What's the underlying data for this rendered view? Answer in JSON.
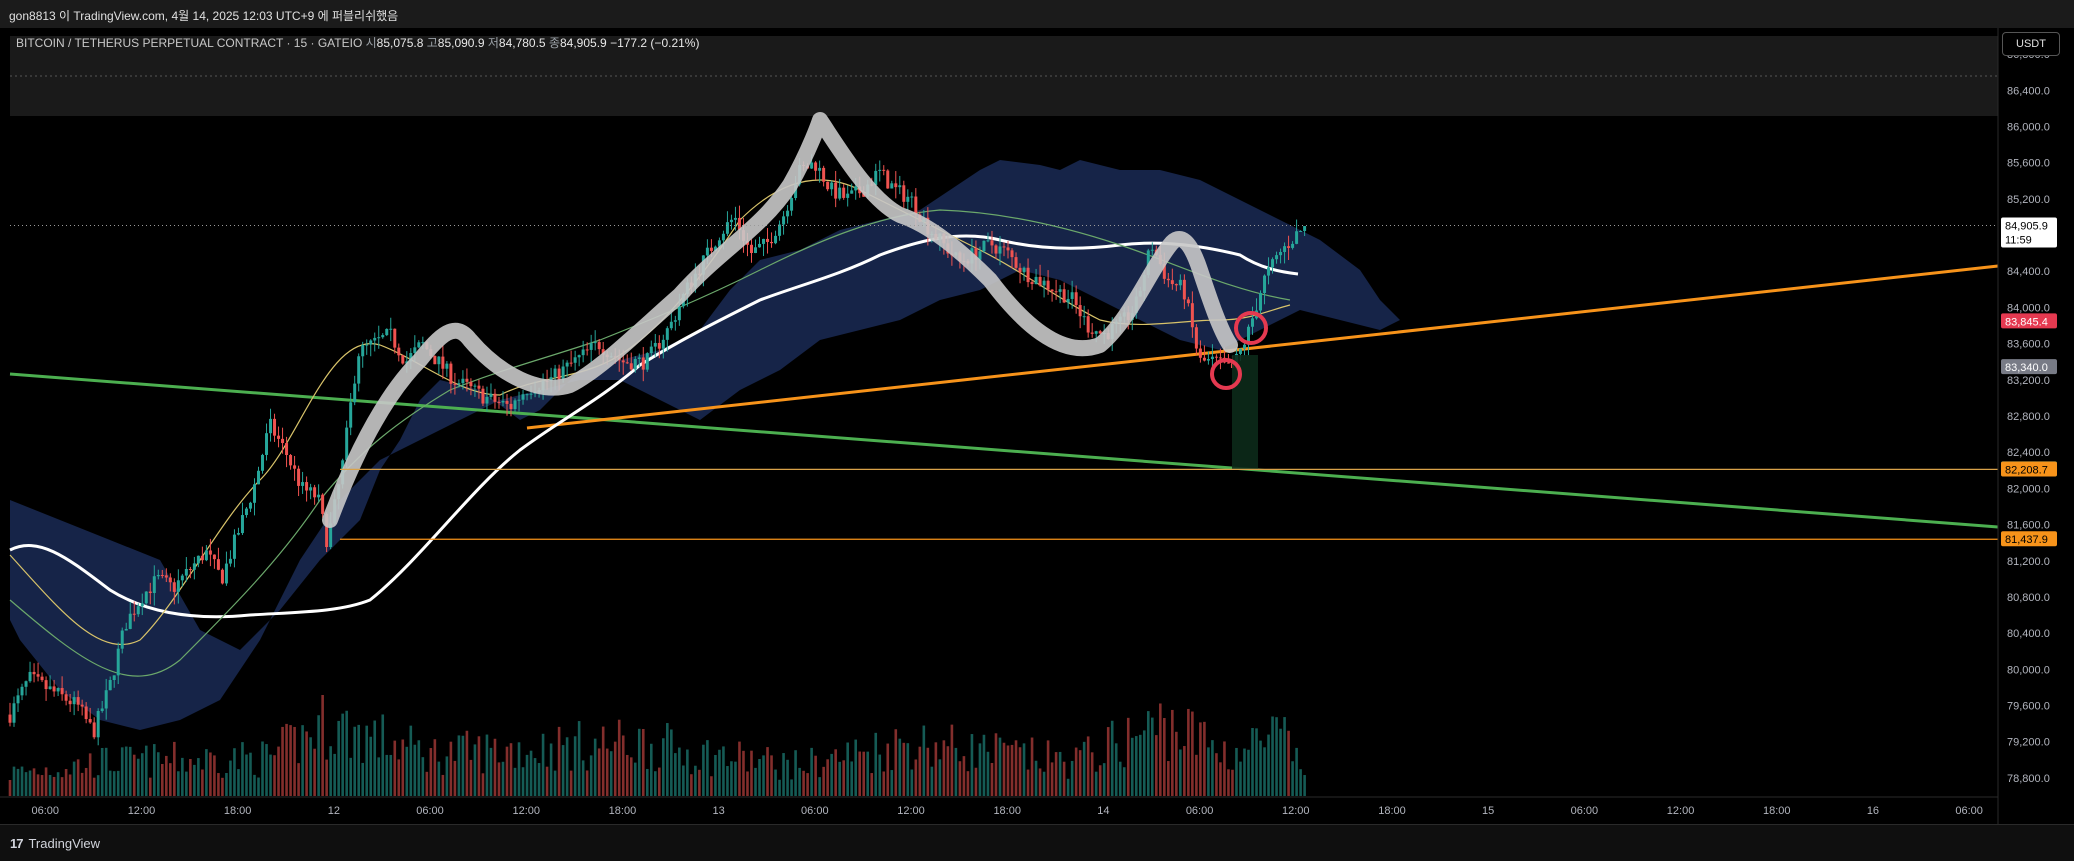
{
  "header": {
    "caption": "gon8813 이 TradingView.com, 4월 14, 2025 12:03 UTC+9 에 퍼블리쉬했음"
  },
  "legend": {
    "symbol": "BITCOIN / TETHERUS PERPETUAL CONTRACT · 15 · GATEIO",
    "open_label": "시",
    "open": "85,075.8",
    "high_label": "고",
    "high": "85,090.9",
    "low_label": "저",
    "low": "84,780.5",
    "close_label": "종",
    "close": "84,905.9",
    "change": "−177.2 (−0.21%)"
  },
  "currency_button": "USDT",
  "footer": {
    "brand": "TradingView",
    "logo": "17"
  },
  "colors": {
    "background": "#000000",
    "up": "#26a69a",
    "down": "#ef5350",
    "orange_trend": "#f7931a",
    "green_trend": "#4caf50",
    "cloud": "#1a2a55",
    "ma_white": "#ffffff",
    "path_sketch": "#c8c8c8",
    "circle_marker": "#e53950"
  },
  "chart_data": {
    "type": "candlestick",
    "ylim": [
      78600,
      87000
    ],
    "y_ticks": [
      "86,800.0",
      "86,400.0",
      "86,000.0",
      "85,600.0",
      "85,200.0",
      "84,800.0",
      "84,400.0",
      "84,000.0",
      "83,600.0",
      "83,200.0",
      "82,800.0",
      "82,400.0",
      "82,000.0",
      "81,600.0",
      "81,200.0",
      "80,800.0",
      "80,400.0",
      "80,000.0",
      "79,600.0",
      "79,200.0",
      "78,800.0"
    ],
    "x_ticks": [
      "06:00",
      "12:00",
      "18:00",
      "12",
      "06:00",
      "12:00",
      "18:00",
      "13",
      "06:00",
      "12:00",
      "18:00",
      "14",
      "06:00",
      "12:00",
      "18:00",
      "15",
      "06:00",
      "12:00",
      "18:00",
      "16",
      "06:00"
    ],
    "x_tick_hours": [
      6,
      12,
      18,
      24,
      30,
      36,
      42,
      48,
      54,
      60,
      66,
      72,
      78,
      84,
      90,
      96,
      102,
      108,
      114,
      120,
      126
    ],
    "x_start_hour": 3.8,
    "x_end_hour": 127.8,
    "price_lines": [
      {
        "label": "84,905.9",
        "sub": "11:59",
        "value": 84905.9,
        "bg": "#ffffff",
        "fg": "#000000",
        "kind": "current"
      },
      {
        "label": "83,845.4",
        "value": 83845.4,
        "bg": "#e53950",
        "fg": "#ffffff",
        "kind": "tag"
      },
      {
        "label": "83,340.0",
        "value": 83340.0,
        "bg": "#787b86",
        "fg": "#ffffff",
        "kind": "tag"
      },
      {
        "label": "82,209.8",
        "value": 82209.8,
        "bg": "#26a69a",
        "fg": "#ffffff",
        "kind": "hline"
      },
      {
        "label": "82,208.7",
        "value": 82208.7,
        "bg": "#f7931a",
        "fg": "#000000",
        "kind": "tag"
      },
      {
        "label": "81,437.9",
        "value": 81437.9,
        "bg": "#f7931a",
        "fg": "#000000",
        "kind": "hline"
      }
    ],
    "close_path": [
      [
        3.8,
        79500
      ],
      [
        5,
        79900
      ],
      [
        6,
        79800
      ],
      [
        7,
        79700
      ],
      [
        8,
        79600
      ],
      [
        9,
        79300
      ],
      [
        10,
        79800
      ],
      [
        11,
        80500
      ],
      [
        12,
        80800
      ],
      [
        13,
        81000
      ],
      [
        14,
        80900
      ],
      [
        15,
        81100
      ],
      [
        16,
        81300
      ],
      [
        17,
        81000
      ],
      [
        18,
        81500
      ],
      [
        19,
        82000
      ],
      [
        20,
        82700
      ],
      [
        21,
        82400
      ],
      [
        22,
        82000
      ],
      [
        23,
        81900
      ],
      [
        23.6,
        81400
      ],
      [
        24.5,
        82200
      ],
      [
        25.5,
        83500
      ],
      [
        26.5,
        83600
      ],
      [
        27.5,
        83700
      ],
      [
        28.5,
        83400
      ],
      [
        29.5,
        83600
      ],
      [
        30.5,
        83400
      ],
      [
        31.5,
        83200
      ],
      [
        32.5,
        83100
      ],
      [
        33.5,
        83000
      ],
      [
        35,
        82900
      ],
      [
        36,
        83100
      ],
      [
        37.5,
        83200
      ],
      [
        39,
        83400
      ],
      [
        40.5,
        83600
      ],
      [
        42,
        83400
      ],
      [
        43.5,
        83400
      ],
      [
        45,
        83800
      ],
      [
        46,
        84200
      ],
      [
        47,
        84500
      ],
      [
        48,
        84800
      ],
      [
        49,
        85000
      ],
      [
        50,
        84600
      ],
      [
        51,
        84700
      ],
      [
        52,
        85000
      ],
      [
        53,
        85500
      ],
      [
        54,
        85600
      ],
      [
        55,
        85300
      ],
      [
        56,
        85200
      ],
      [
        57,
        85300
      ],
      [
        58,
        85500
      ],
      [
        59,
        85300
      ],
      [
        60,
        85200
      ],
      [
        61,
        84900
      ],
      [
        62,
        84700
      ],
      [
        63,
        84500
      ],
      [
        64,
        84600
      ],
      [
        65,
        84700
      ],
      [
        66,
        84600
      ],
      [
        67,
        84400
      ],
      [
        68,
        84300
      ],
      [
        69,
        84200
      ],
      [
        70,
        84100
      ],
      [
        71,
        83800
      ],
      [
        72,
        83700
      ],
      [
        73,
        83800
      ],
      [
        74,
        84000
      ],
      [
        75,
        84700
      ],
      [
        76,
        84300
      ],
      [
        77,
        84200
      ],
      [
        78,
        83400
      ],
      [
        79,
        83400
      ],
      [
        80,
        83300
      ],
      [
        81,
        83700
      ],
      [
        82,
        84300
      ],
      [
        83,
        84600
      ],
      [
        84,
        84800
      ],
      [
        84.7,
        84905.9
      ]
    ],
    "volume_path": [
      [
        3.8,
        0.3
      ],
      [
        10,
        0.45
      ],
      [
        20,
        0.5
      ],
      [
        23.5,
        0.95
      ],
      [
        30,
        0.55
      ],
      [
        43,
        0.7
      ],
      [
        47,
        0.55
      ],
      [
        53,
        0.4
      ],
      [
        60,
        0.7
      ],
      [
        70,
        0.45
      ],
      [
        76,
        0.95
      ],
      [
        80,
        0.55
      ],
      [
        83,
        0.8
      ],
      [
        84.7,
        0.25
      ]
    ],
    "volume_max_px": 105
  }
}
